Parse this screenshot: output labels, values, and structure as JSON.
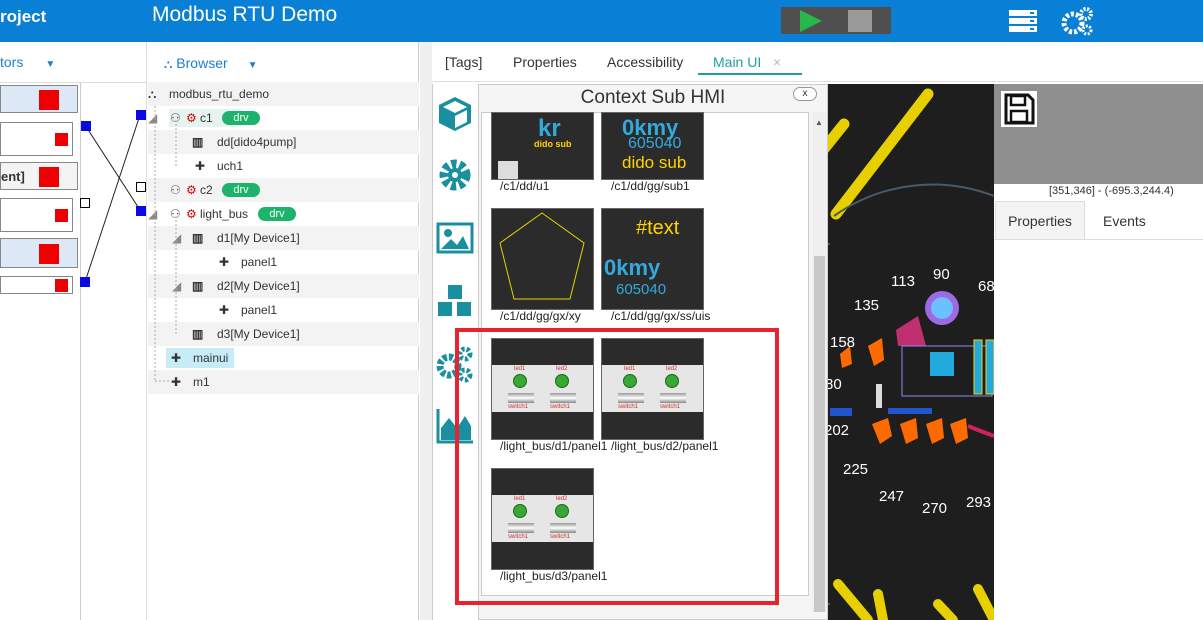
{
  "header": {
    "project_label": "roject",
    "app_title": "Modbus RTU Demo"
  },
  "left_panel": {
    "heading": "tors",
    "item_text": "ent]"
  },
  "browser": {
    "heading": "Browser",
    "tree": [
      {
        "label": "modbus_rtu_demo"
      },
      {
        "label": "c1",
        "badge": "drv"
      },
      {
        "label": "dd[dido4pump]"
      },
      {
        "label": "uch1"
      },
      {
        "label": "c2",
        "badge": "drv"
      },
      {
        "label": "light_bus",
        "badge": "drv"
      },
      {
        "label": "d1[My Device1]"
      },
      {
        "label": "panel1"
      },
      {
        "label": "d2[My Device1]"
      },
      {
        "label": "panel1"
      },
      {
        "label": "d3[My Device1]"
      },
      {
        "label": "mainui"
      },
      {
        "label": "m1"
      }
    ]
  },
  "tabs": [
    {
      "label": "[Tags]"
    },
    {
      "label": "Properties"
    },
    {
      "label": "Accessibility"
    },
    {
      "label": "Main UI"
    }
  ],
  "tab_close": "×",
  "context_sub_hmi": {
    "title": "Context Sub HMI",
    "close_label": "x",
    "items": [
      {
        "path": "/c1/dd/u1",
        "thumb_text": "dido sub"
      },
      {
        "path": "/c1/dd/gg/sub1",
        "thumb_text": "dido sub"
      },
      {
        "path": "/c1/dd/gg/gx/xy"
      },
      {
        "path": "/c1/dd/gg/gx/ss/uis",
        "thumb_text": "#text"
      },
      {
        "path": "/light_bus/d1/panel1"
      },
      {
        "path": "/light_bus/d2/panel1"
      },
      {
        "path": "/light_bus/d3/panel1"
      }
    ],
    "thumb_numbers": "605040",
    "panel_labels": {
      "led1": "led1",
      "led2": "led2",
      "switch1": "switch1"
    }
  },
  "canvas": {
    "gauge_numbers": [
      "90",
      "113",
      "68",
      "135",
      "158",
      "80",
      "202",
      "225",
      "247",
      "270",
      "293"
    ]
  },
  "right_panel": {
    "coords": "[351,346] - (-695.3,244.4)",
    "tabs": [
      "Properties",
      "Events"
    ]
  },
  "colors": {
    "topbar": "#0a7fd6",
    "accent_tab": "#1f9fa0",
    "badge": "#1db36b",
    "highlight": "#e6232e"
  }
}
